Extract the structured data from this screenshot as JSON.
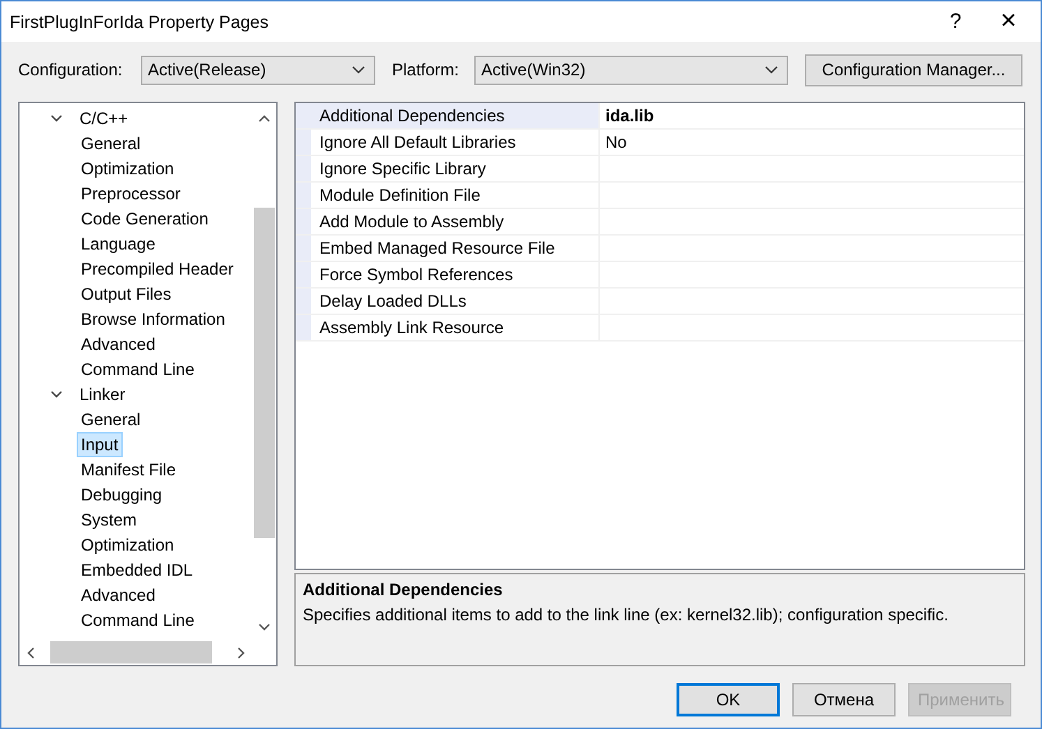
{
  "window": {
    "title": "FirstPlugInForIda Property Pages",
    "help": "?",
    "close": "×"
  },
  "toolbar": {
    "configuration_label": "Configuration:",
    "configuration": "Active(Release)",
    "platform_label": "Platform:",
    "platform": "Active(Win32)",
    "manager_button": "Configuration Manager..."
  },
  "tree": [
    {
      "label": "C/C++",
      "expanded": true,
      "selected": false,
      "children": [
        {
          "label": "General",
          "selected": false
        },
        {
          "label": "Optimization",
          "selected": false
        },
        {
          "label": "Preprocessor",
          "selected": false
        },
        {
          "label": "Code Generation",
          "selected": false
        },
        {
          "label": "Language",
          "selected": false
        },
        {
          "label": "Precompiled Header",
          "selected": false
        },
        {
          "label": "Output Files",
          "selected": false
        },
        {
          "label": "Browse Information",
          "selected": false
        },
        {
          "label": "Advanced",
          "selected": false
        },
        {
          "label": "Command Line",
          "selected": false
        }
      ]
    },
    {
      "label": "Linker",
      "expanded": true,
      "selected": false,
      "children": [
        {
          "label": "General",
          "selected": false
        },
        {
          "label": "Input",
          "selected": true
        },
        {
          "label": "Manifest File",
          "selected": false
        },
        {
          "label": "Debugging",
          "selected": false
        },
        {
          "label": "System",
          "selected": false
        },
        {
          "label": "Optimization",
          "selected": false
        },
        {
          "label": "Embedded IDL",
          "selected": false
        },
        {
          "label": "Advanced",
          "selected": false
        },
        {
          "label": "Command Line",
          "selected": false
        }
      ]
    }
  ],
  "properties": [
    {
      "name": "Additional Dependencies",
      "value": "ida.lib",
      "modified": true,
      "selected": true
    },
    {
      "name": "Ignore All Default Libraries",
      "value": "No",
      "modified": false,
      "selected": false
    },
    {
      "name": "Ignore Specific Library",
      "selected": false
    },
    {
      "name": "Module Definition File",
      "selected": false
    },
    {
      "name": "Add Module to Assembly",
      "selected": false
    },
    {
      "name": "Embed Managed Resource File",
      "selected": false
    },
    {
      "name": "Force Symbol References",
      "selected": false
    },
    {
      "name": "Delay Loaded DLLs",
      "selected": false
    },
    {
      "name": "Assembly Link Resource",
      "selected": false
    }
  ],
  "description": {
    "title": "Additional Dependencies",
    "text": "Specifies additional items to add to the link line (ex: kernel32.lib); configuration specific."
  },
  "buttons": [
    {
      "label": "OK",
      "kind": "default",
      "disabled": false
    },
    {
      "label": "Отмена",
      "kind": "normal",
      "disabled": false
    },
    {
      "label": "Применить",
      "kind": "normal",
      "disabled": true
    }
  ]
}
